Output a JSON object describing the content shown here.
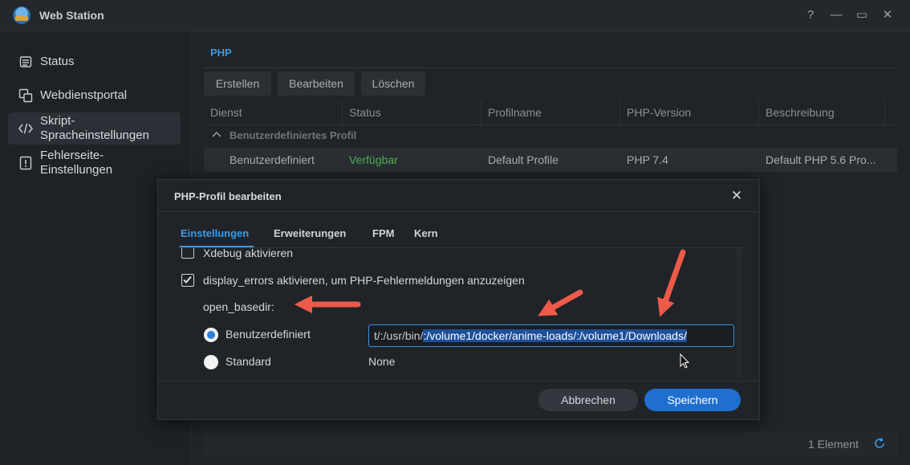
{
  "window": {
    "title": "Web Station",
    "controls": [
      "?",
      "—",
      "▭",
      "✕"
    ]
  },
  "sidebar": {
    "items": [
      {
        "label": "Status",
        "icon": "status-icon"
      },
      {
        "label": "Webdienstportal",
        "icon": "portal-icon"
      },
      {
        "label": "Skript-Spracheinstellungen",
        "line1": "Skript-",
        "line2": "Spracheinstellungen",
        "icon": "code-icon",
        "active": true
      },
      {
        "label": "Fehlerseite-Einstellungen",
        "line1": "Fehlerseite-",
        "line2": "Einstellungen",
        "icon": "error-page-icon"
      }
    ]
  },
  "main": {
    "tab": "PHP",
    "toolbar": {
      "create": "Erstellen",
      "edit": "Bearbeiten",
      "delete": "Löschen"
    },
    "columns": [
      "Dienst",
      "Status",
      "Profilname",
      "PHP-Version",
      "Beschreibung"
    ],
    "group_label": "Benutzerdefiniertes Profil",
    "row": {
      "service": "Benutzerdefiniert",
      "status": "Verfügbar",
      "profile": "Default Profile",
      "version": "PHP 7.4",
      "description": "Default PHP 5.6 Pro..."
    },
    "footer_count": "1 Element"
  },
  "dialog": {
    "title": "PHP-Profil bearbeiten",
    "tabs": [
      "Einstellungen",
      "Erweiterungen",
      "FPM",
      "Kern"
    ],
    "xdebug_label": "Xdebug aktivieren",
    "display_errors_label": "display_errors aktivieren, um PHP-Fehlermeldungen anzuzeigen",
    "open_basedir_label": "open_basedir:",
    "custom_label": "Benutzerdefiniert",
    "custom_value_plain": "t/:/usr/bin/",
    "custom_value_selected": ":/volume1/docker/anime-loads/:/volume1/Downloads/",
    "standard_label": "Standard",
    "standard_value": "None",
    "cancel": "Abbrechen",
    "save": "Speichern"
  },
  "colors": {
    "accent": "#3b9ae6",
    "available": "#4caf50",
    "annotation_arrow": "#ee5a4a",
    "save_button": "#1f6fd1"
  }
}
